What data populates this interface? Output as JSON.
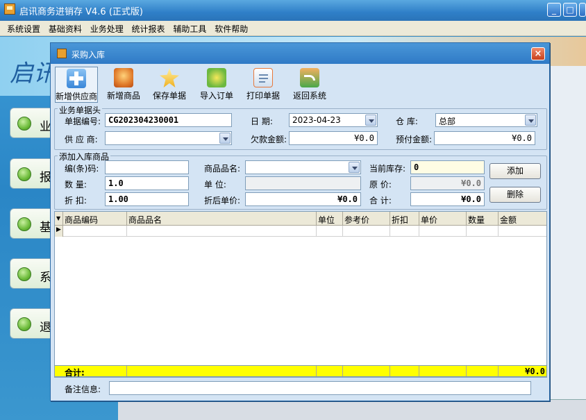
{
  "app": {
    "title": "启讯商务进销存 V4.6 (正式版)",
    "menu": [
      "系统设置",
      "基础资料",
      "业务处理",
      "统计报表",
      "辅助工具",
      "软件帮助"
    ],
    "window_buttons": {
      "minimize": "_",
      "maximize": "□",
      "close": "×"
    },
    "side_buttons": [
      "业",
      "报",
      "基",
      "系",
      "退"
    ],
    "banner_text": "启讯"
  },
  "dialog": {
    "title": "采购入库",
    "close_glyph": "×",
    "toolbar": [
      {
        "label": "新增供应商",
        "icon": "add-supplier-icon",
        "color": "#4f9ae0"
      },
      {
        "label": "新增商品",
        "icon": "add-product-icon",
        "color": "#e07a2a"
      },
      {
        "label": "保存单据",
        "icon": "save-star-icon",
        "color": "#f0b020"
      },
      {
        "label": "导入订单",
        "icon": "import-order-icon",
        "color": "#6cb840"
      },
      {
        "label": "打印单据",
        "icon": "print-icon",
        "color": "#e8783a"
      },
      {
        "label": "返回系统",
        "icon": "return-icon",
        "color": "#4aa84a"
      }
    ],
    "header_group": {
      "title": "业务单据头",
      "doc_no_label": "单据编号:",
      "doc_no_value": "CG202304230001",
      "date_label": "日    期:",
      "date_value": "2023-04-23",
      "warehouse_label": "仓    库:",
      "warehouse_value": "总部",
      "supplier_label": "供 应 商:",
      "supplier_value": "",
      "debt_label": "欠款金额:",
      "debt_value": "¥0.0",
      "prepaid_label": "预付金额:",
      "prepaid_value": "¥0.0"
    },
    "item_group": {
      "title": "添加入库商品",
      "code_label": "编(条)码:",
      "code_value": "",
      "name_label": "商品品名:",
      "name_value": "",
      "stock_label": "当前库存:",
      "stock_value": "0",
      "qty_label": "数    量:",
      "qty_value": "1.0",
      "unit_label": "单    位:",
      "unit_value": "",
      "orig_price_label": "原    价:",
      "orig_price_value": "¥0.0",
      "discount_label": "折    扣:",
      "discount_value": "1.00",
      "disc_price_label": "折后单价:",
      "disc_price_value": "¥0.0",
      "total_label": "合    计:",
      "total_value": "¥0.0",
      "add_button": "添加",
      "delete_button": "删除"
    },
    "grid": {
      "columns": [
        "商品编码",
        "商品品名",
        "单位",
        "参考价",
        "折扣",
        "单价",
        "数量",
        "金额"
      ],
      "footer_label": "合计:",
      "footer_total": "¥0.0"
    },
    "notes": {
      "label": "备注信息:",
      "value": ""
    }
  }
}
